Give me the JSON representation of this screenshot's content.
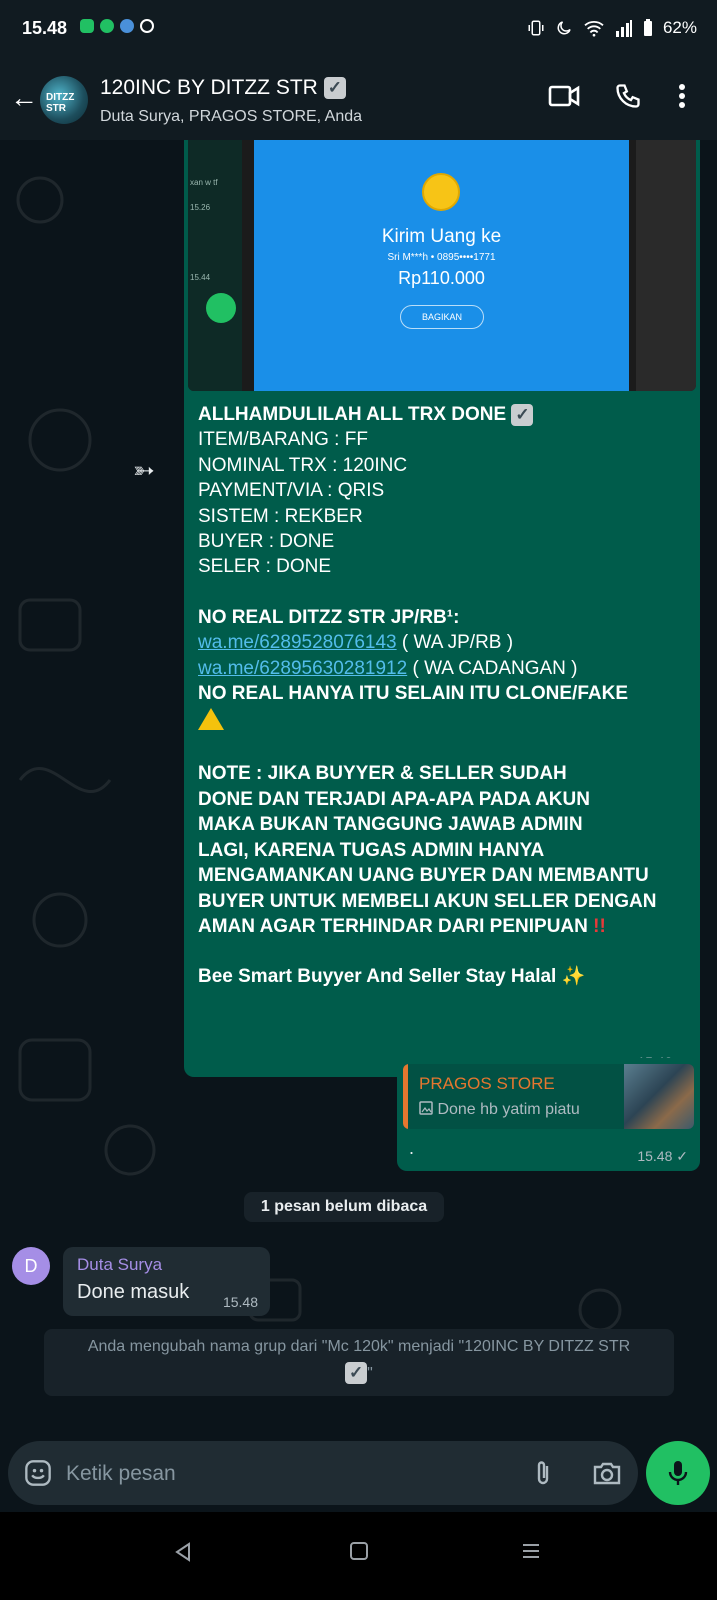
{
  "status_bar": {
    "time": "15.48",
    "battery": "62%"
  },
  "header": {
    "title": "120INC BY DITZZ STR",
    "subtitle": "Duta Surya, PRAGOS STORE, Anda",
    "avatar_text": "DITZZ STR"
  },
  "forwarded_image": {
    "left_time_1": "15.26",
    "left_time_2": "15.44",
    "left_snippet": "xan w tf",
    "heading": "Kirim Uang ke",
    "recipient": "Sri M***h • 0895••••1771",
    "amount": "Rp110.000",
    "share_label": "BAGIKAN"
  },
  "forwarded_message": {
    "line1": "ALLHAMDULILAH ALL TRX DONE",
    "line2": "ITEM/BARANG : FF",
    "line3": "NOMINAL TRX : 120INC",
    "line4": "PAYMENT/VIA : QRIS",
    "line5": "SISTEM : REKBER",
    "line6": "BUYER : DONE",
    "line7": "SELER : DONE",
    "line8": "NO REAL DITZZ STR JP/RB¹:",
    "link1": "wa.me/6289528076143",
    "link1_suffix": " ( WA JP/RB )",
    "link2": "wa.me/62895630281912",
    "link2_suffix": " ( WA CADANGAN )",
    "line11": "NO REAL HANYA ITU SELAIN ITU CLONE/FAKE",
    "note1": "NOTE : JIKA BUYYER & SELLER SUDAH",
    "note2": "DONE DAN TERJADI APA-APA PADA AKUN",
    "note3": "MAKA BUKAN TANGGUNG JAWAB ADMIN",
    "note4": "LAGI, KARENA TUGAS ADMIN HANYA",
    "note5": "MENGAMANKAN UANG BUYER DAN MEMBANTU",
    "note6": "BUYER UNTUK MEMBELI AKUN SELLER DENGAN",
    "note7": "AMAN AGAR TERHINDAR DARI PENIPUAN",
    "closing": "Bee Smart Buyyer And Seller Stay Halal",
    "time": "15.48 ✓"
  },
  "reply_message": {
    "quote_name": "PRAGOS STORE",
    "quote_text": "Done hb yatim piatu",
    "text": ".",
    "time": "15.48 ✓"
  },
  "unread_label": "1 pesan belum dibaca",
  "incoming_message": {
    "avatar_letter": "D",
    "sender": "Duta Surya",
    "text": "Done masuk",
    "time": "15.48"
  },
  "system_message": {
    "text": "Anda mengubah nama grup dari \"Mc 120k\" menjadi \"120INC BY DITZZ STR",
    "text_end": "\""
  },
  "composer": {
    "placeholder": "Ketik pesan"
  },
  "colors": {
    "outgoing_bubble": "#005c4b",
    "incoming_bubble": "#202c33",
    "accent_green": "#21c063",
    "link": "#53bdeb",
    "quote_name": "#e5772f",
    "sender_name": "#a58ee6"
  },
  "icons": {
    "back": "arrow-left-icon",
    "video": "video-call-icon",
    "call": "phone-icon",
    "menu": "more-vert-icon",
    "forward": "forwarded-icon",
    "emoji": "emoji-icon",
    "attach": "paperclip-icon",
    "camera": "camera-icon",
    "mic": "mic-icon"
  }
}
